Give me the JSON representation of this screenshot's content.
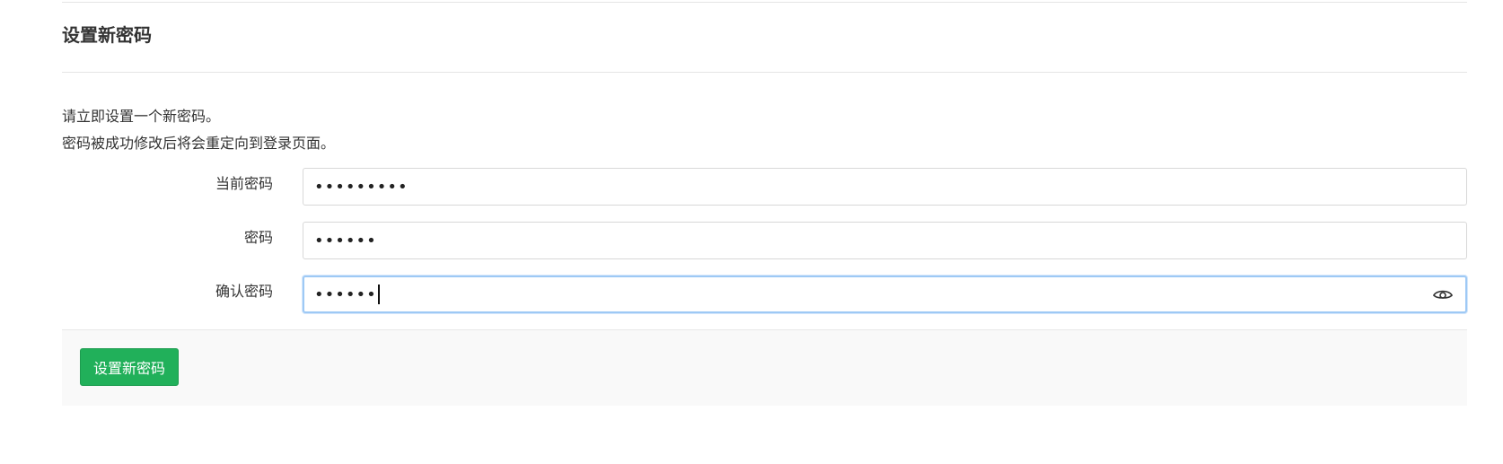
{
  "header": {
    "title": "设置新密码"
  },
  "intro": {
    "line1": "请立即设置一个新密码。",
    "line2": "密码被成功修改后将会重定向到登录页面。"
  },
  "form": {
    "current_password": {
      "label": "当前密码",
      "value": "•••••••••"
    },
    "new_password": {
      "label": "密码",
      "value": "••••••"
    },
    "confirm_password": {
      "label": "确认密码",
      "value": "••••••",
      "show_password_icon": "eye-icon"
    }
  },
  "footer": {
    "submit_label": "设置新密码"
  },
  "colors": {
    "primary_button": "#21b05a",
    "focus_border": "#9ec9f5"
  }
}
